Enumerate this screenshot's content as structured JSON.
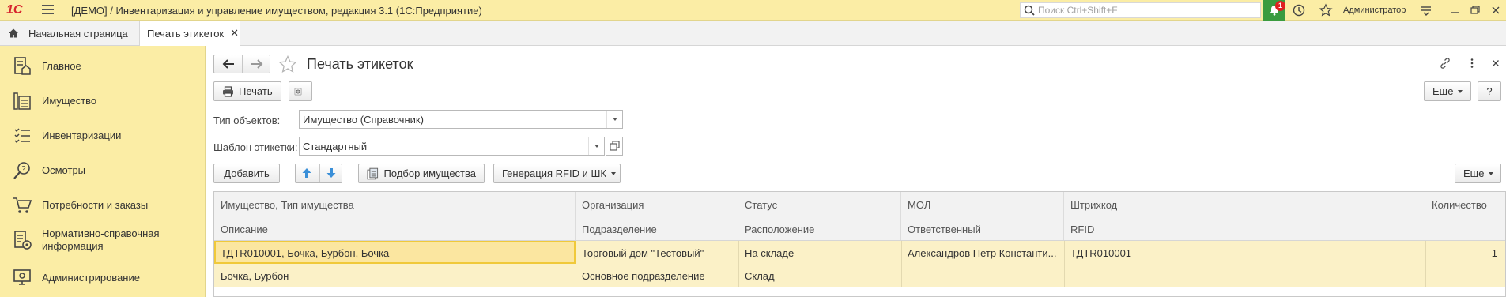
{
  "window": {
    "logo_text": "1С",
    "title": "[ДЕМО] / Инвентаризация и управление имуществом, редакция 3.1  (1С:Предприятие)",
    "search_placeholder": "Поиск Ctrl+Shift+F",
    "notifications_count": "1",
    "user": "Администратор"
  },
  "tabs": {
    "home": "Начальная страница",
    "active": "Печать этикеток"
  },
  "sidebar": {
    "items": [
      {
        "label": "Главное",
        "icon": "home-doc-icon"
      },
      {
        "label": "Имущество",
        "icon": "property-icon"
      },
      {
        "label": "Инвентаризации",
        "icon": "checklist-icon"
      },
      {
        "label": "Осмотры",
        "icon": "magnifier-icon"
      },
      {
        "label": "Потребности и заказы",
        "icon": "cart-icon"
      },
      {
        "label": "Нормативно-справочная информация",
        "icon": "reference-icon"
      },
      {
        "label": "Администрирование",
        "icon": "admin-icon"
      }
    ]
  },
  "form": {
    "title": "Печать этикеток",
    "print_button": "Печать",
    "more_button": "Еще",
    "help_button": "?",
    "object_type_label": "Тип объектов:",
    "object_type_value": "Имущество (Справочник)",
    "template_label": "Шаблон этикетки:",
    "template_value": "Стандартный",
    "add_button": "Добавить",
    "select_property_button": "Подбор имущества",
    "generate_button": "Генерация RFID и ШК",
    "table_more_button": "Еще"
  },
  "table": {
    "headers_top": [
      "Имущество, Тип имущества",
      "Организация",
      "Статус",
      "МОЛ",
      "Штрихкод",
      "Количество"
    ],
    "headers_bottom": [
      "Описание",
      "Подразделение",
      "Расположение",
      "Ответственный",
      "RFID",
      ""
    ],
    "rows": [
      {
        "top": [
          "ТДТR010001, Бочка, Бурбон, Бочка",
          "Торговый дом \"Тестовый\"",
          "На складе",
          "Александров Петр Константи...",
          "ТДТR010001",
          "1"
        ],
        "bottom": [
          "Бочка, Бурбон",
          "Основное подразделение",
          "Склад",
          "",
          "",
          ""
        ]
      }
    ]
  }
}
